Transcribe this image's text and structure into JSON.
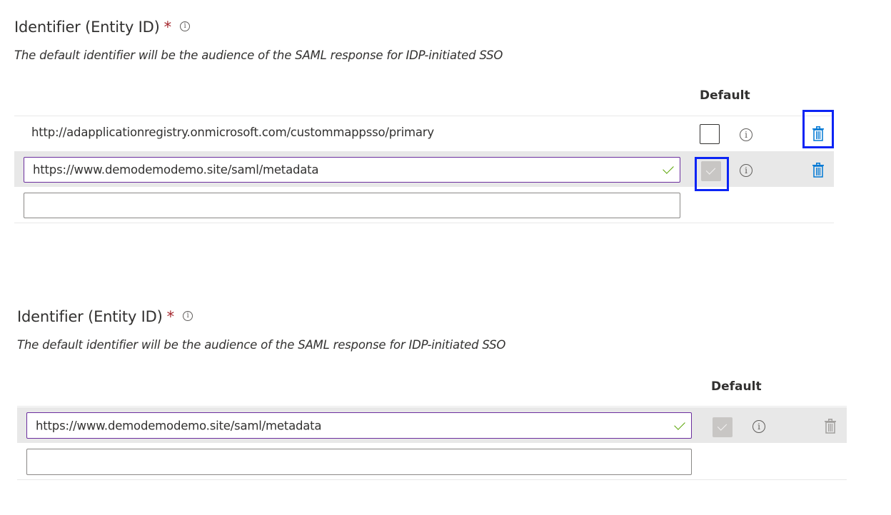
{
  "top": {
    "title": "Identifier (Entity ID)",
    "required_mark": "*",
    "subtitle": "The default identifier will be the audience of the SAML response for IDP-initiated SSO",
    "default_header": "Default",
    "rows": [
      {
        "value": "http://adapplicationregistry.onmicrosoft.com/custommappsso/primary",
        "default_checked": false,
        "editing": false
      },
      {
        "value": "https://www.demodemodemo.site/saml/metadata",
        "default_checked": true,
        "editing": true,
        "valid": true
      }
    ],
    "new_value": ""
  },
  "bottom": {
    "title": "Identifier (Entity ID)",
    "required_mark": "*",
    "subtitle": "The default identifier will be the audience of the SAML response for IDP-initiated SSO",
    "default_header": "Default",
    "rows": [
      {
        "value": "https://www.demodemodemo.site/saml/metadata",
        "default_checked": true,
        "editing": true,
        "valid": true
      }
    ],
    "new_value": ""
  },
  "icons": {
    "info": "info-icon",
    "delete": "trash-icon",
    "valid": "checkmark-icon"
  },
  "colors": {
    "highlight": "#0b24f5",
    "trash_active": "#0078d4",
    "trash_disabled": "#a19f9d",
    "required": "#a4262c",
    "valid_check": "#57a300",
    "focus_border": "#6b2e9e"
  }
}
